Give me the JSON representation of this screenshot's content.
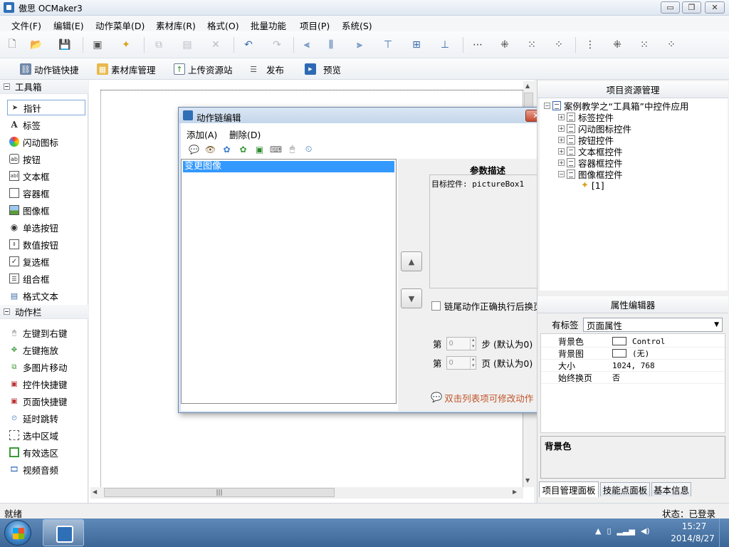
{
  "window": {
    "title": "傲思 OCMaker3",
    "controls": {
      "minimize": "▭",
      "maximize": "❐",
      "close": "✕"
    }
  },
  "menu": [
    "文件(F)",
    "编辑(E)",
    "动作菜单(D)",
    "素材库(R)",
    "格式(O)",
    "批量功能",
    "项目(P)",
    "系统(S)"
  ],
  "toolbar2": [
    {
      "label": "动作链快捷",
      "icon": "action-chain-icon"
    },
    {
      "label": "素材库管理",
      "icon": "library-icon"
    },
    {
      "label": "上传资源站",
      "icon": "upload-icon"
    },
    {
      "label": "发布",
      "icon": "publish-icon"
    },
    {
      "label": "预览",
      "icon": "preview-icon"
    }
  ],
  "toolbox": {
    "section1": "工具箱",
    "tools": [
      "指针",
      "标签",
      "闪动图标",
      "按钮",
      "文本框",
      "容器框",
      "图像框",
      "单选按钮",
      "数值按钮",
      "复选框",
      "组合框",
      "格式文本"
    ],
    "section2": "动作栏",
    "actions": [
      "左键到右键",
      "左键拖放",
      "多图片移动",
      "控件快捷键",
      "页面快捷键",
      "延时跳转",
      "选中区域",
      "有效选区",
      "视频音频"
    ]
  },
  "dialog": {
    "title": "动作链编辑",
    "close": "✕",
    "menu": [
      "添加(A)",
      "删除(D)"
    ],
    "list_items": [
      "变更图像"
    ],
    "param_title": "参数描述",
    "param_text": "目标控件: pictureBox1",
    "checkbox_label": "链尾动作正确执行后换页",
    "step_prefix": "第",
    "step_value": "0",
    "step_suffix": "步 (默认为0)",
    "page_prefix": "第",
    "page_value": "0",
    "page_suffix": "页 (默认为0)",
    "hint": "双击列表项可修改动作",
    "up_arrow": "▲",
    "down_arrow": "▼"
  },
  "project_panel": {
    "title": "项目资源管理",
    "root": "案例教学之“工具箱”中控件应用",
    "children": [
      "标签控件",
      "闪动图标控件",
      "按钮控件",
      "文本框控件",
      "容器框控件",
      "图像框控件"
    ],
    "leaf": "[1]"
  },
  "property_editor": {
    "title": "属性编辑器",
    "tag_label": "有标签",
    "selected": "页面属性",
    "rows": [
      {
        "key": "背景色",
        "value": "Control",
        "swatch": true
      },
      {
        "key": "背景图",
        "value": "(无)",
        "swatch": true
      },
      {
        "key": "大小",
        "value": "1024, 768",
        "swatch": false
      },
      {
        "key": "始终换页",
        "value": "否",
        "swatch": false
      }
    ],
    "description_title": "背景色"
  },
  "tabs": [
    "项目管理面板",
    "技能点面板",
    "基本信息"
  ],
  "status": {
    "left": "就绪",
    "right": "状态：已登录"
  },
  "taskbar": {
    "time": "15:27",
    "date": "2014/8/27"
  },
  "colors": {
    "selection": "#3399ff",
    "hint": "#c0552a",
    "taskbar": "#3b6696"
  }
}
